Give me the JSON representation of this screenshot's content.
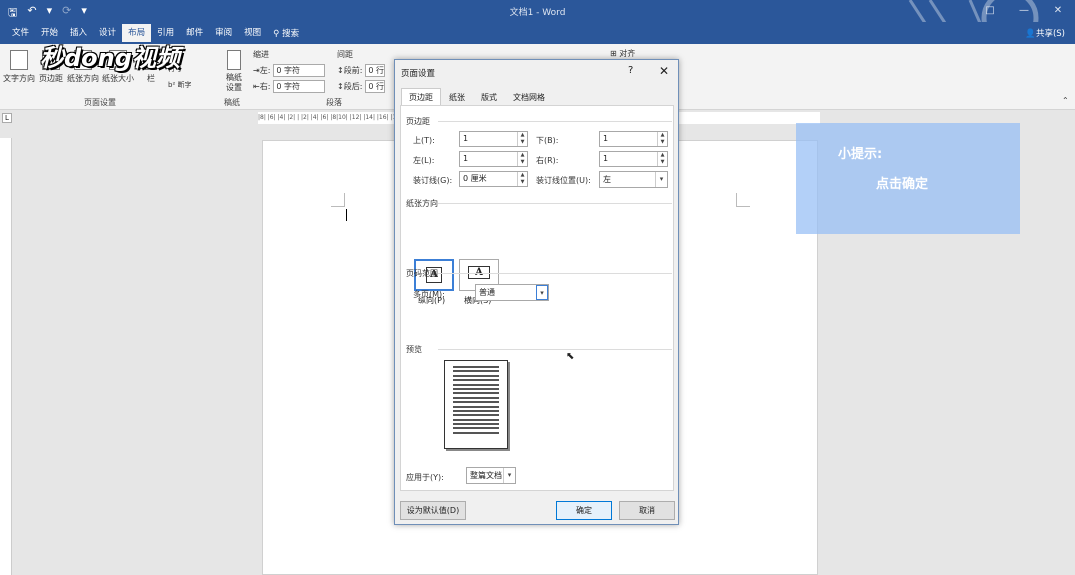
{
  "window": {
    "title": "文档1 - Word",
    "controls": [
      "□",
      "—",
      "✕"
    ]
  },
  "qat": {
    "save": "🖫",
    "undo": "↶",
    "undo_dd": "▾",
    "redo": "⟳",
    "more": "▾"
  },
  "menu": {
    "tabs": [
      "文件",
      "开始",
      "插入",
      "设计",
      "布局",
      "引用",
      "邮件",
      "审阅",
      "视图"
    ],
    "active_index": 4,
    "search": "搜索",
    "share": "共享(S)"
  },
  "ribbon": {
    "buttons": [
      "文字方向",
      "页边距",
      "纸张方向",
      "纸张大小",
      "栏",
      "稿纸设置"
    ],
    "page_setup_extras": [
      "符",
      "行号",
      "断字"
    ],
    "groups": [
      "页面设置",
      "稿纸",
      "段落"
    ],
    "indent": {
      "header": "缩进",
      "left_label": "左:",
      "left_value": "0 字符",
      "right_label": "右:",
      "right_value": "0 字符"
    },
    "spacing": {
      "header": "间距",
      "before_label": "段前:",
      "before_value": "0 行",
      "after_label": "段后:",
      "after_value": "0 行"
    },
    "arrange": {
      "align": "对齐"
    }
  },
  "watermark_logo": "秒dong视频",
  "ruler": {
    "ticks": "|8| |6| |4| |2| |  |2| |4| |6| |8|10| |12| |14| |16| |18| |20| |22| |24| |26| |28| |30| |32| |34| |36| |38| |40| |42| |44| |46| |48|"
  },
  "tip": {
    "line1": "小提示:",
    "line2": "点击确定"
  },
  "dialog": {
    "title": "页面设置",
    "help": "?",
    "close": "✕",
    "tabs": [
      "页边距",
      "纸张",
      "版式",
      "文档网格"
    ],
    "active_tab": 0,
    "margins_section": "页边距",
    "top_label": "上(T):",
    "top_value": "1",
    "bottom_label": "下(B):",
    "bottom_value": "1",
    "left_label": "左(L):",
    "left_value": "1",
    "right_label": "右(R):",
    "right_value": "1",
    "gutter_label": "装订线(G):",
    "gutter_value": "0 厘米",
    "gutter_pos_label": "装订线位置(U):",
    "gutter_pos_value": "左",
    "orientation_section": "纸张方向",
    "portrait_label": "纵向(P)",
    "landscape_label": "横向(S)",
    "portrait_glyph": "A",
    "landscape_glyph": "A",
    "pages_section": "页码范围",
    "multi_label": "多页(M):",
    "multi_value": "普通",
    "preview_section": "预览",
    "apply_label": "应用于(Y):",
    "apply_value": "整篇文档",
    "default_button": "设为默认值(D)",
    "ok_button": "确定",
    "cancel_button": "取消"
  },
  "colors": {
    "titlebar": "#2b579a",
    "ribbon": "#f3f3f3",
    "tip": "#96bef5"
  }
}
